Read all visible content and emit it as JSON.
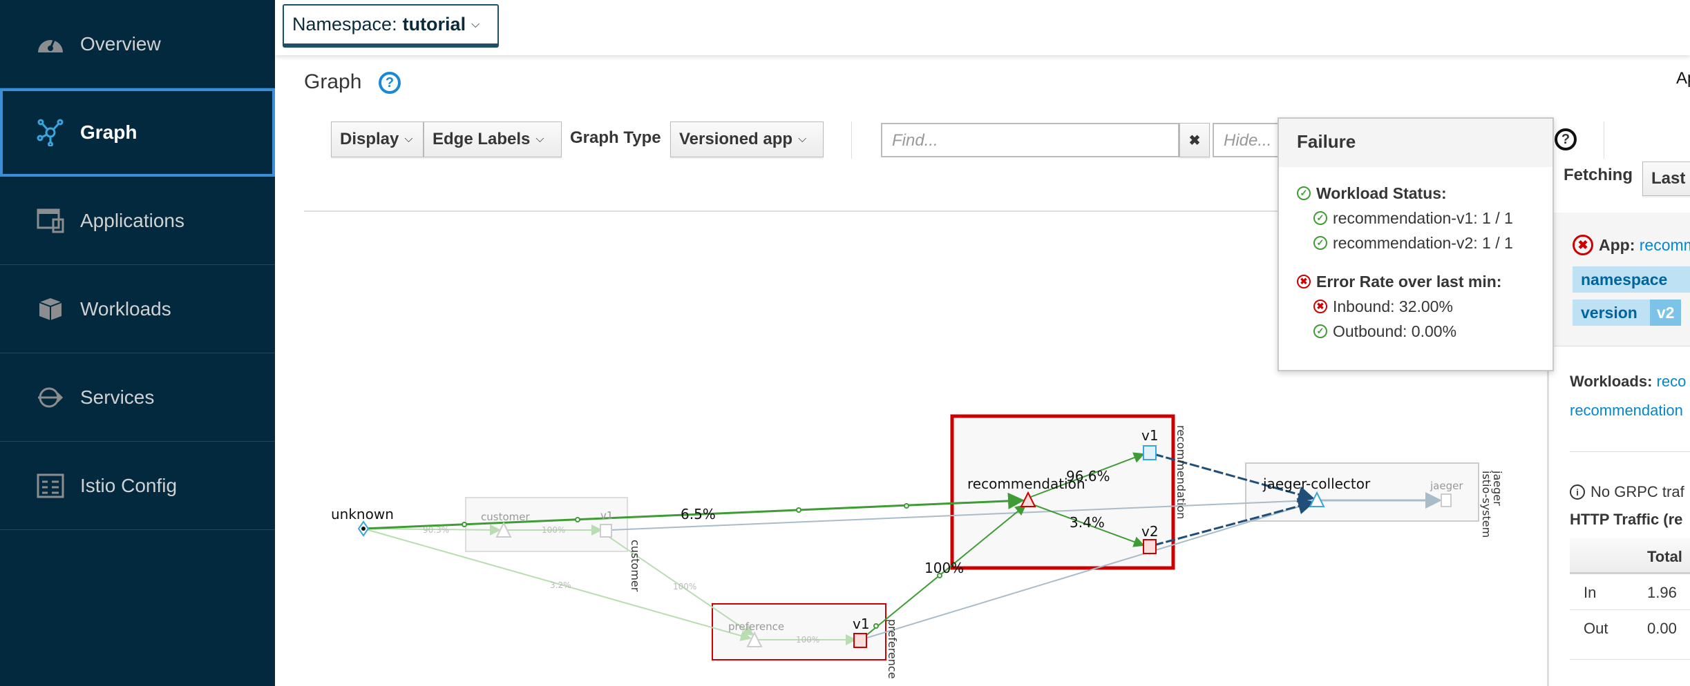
{
  "sidebar": {
    "items": [
      {
        "label": "Overview",
        "icon": "dashboard-icon"
      },
      {
        "label": "Graph",
        "icon": "topology-icon",
        "active": true
      },
      {
        "label": "Applications",
        "icon": "applications-icon"
      },
      {
        "label": "Workloads",
        "icon": "workloads-icon"
      },
      {
        "label": "Services",
        "icon": "services-icon"
      },
      {
        "label": "Istio Config",
        "icon": "config-icon"
      }
    ]
  },
  "header": {
    "namespace_prefix": "Namespace:",
    "namespace": "tutorial"
  },
  "page": {
    "title": "Graph",
    "right_cut_text": "Ap"
  },
  "toolbar": {
    "display": "Display",
    "edge_labels": "Edge Labels",
    "graph_type_label": "Graph Type",
    "graph_type": "Versioned app",
    "find_placeholder": "Find...",
    "hide_placeholder": "Hide...",
    "clear": "✖",
    "fetching_label": "Fetching",
    "fetching_value": "Last"
  },
  "popover": {
    "title": "Failure",
    "workload_status": "Workload Status:",
    "workloads": [
      "recommendation-v1: 1 / 1",
      "recommendation-v2: 1 / 1"
    ],
    "error_rate": "Error Rate over last min:",
    "inbound": "Inbound: 32.00%",
    "outbound": "Outbound: 0.00%"
  },
  "side_panel": {
    "app_label": "App:",
    "app_value": "recomm",
    "badges": [
      {
        "key": "namespace",
        "value": ""
      },
      {
        "key": "version",
        "value": "v2"
      }
    ],
    "workloads_label": "Workloads:",
    "workloads_link1": "reco",
    "workloads_link2": "recommendation",
    "grpc_note": "No GRPC traf",
    "http_title": "HTTP Traffic (re",
    "table": {
      "header": [
        "",
        "Total"
      ],
      "rows": [
        [
          "In",
          "1.96"
        ],
        [
          "Out",
          "0.00"
        ]
      ]
    }
  },
  "graph": {
    "nodes": {
      "unknown": "unknown",
      "customer": "customer",
      "customer_v1": "v1",
      "customer_box": "customer",
      "preference": "preference",
      "preference_v1": "v1",
      "preference_box": "preference",
      "recommendation": "recommendation",
      "rec_v1": "v1",
      "rec_v2": "v2",
      "rec_box": "recommendation",
      "jaeger_collector": "jaeger-collector",
      "jaeger": "jaeger",
      "jaeger_box_app": "jaeger",
      "jaeger_box_ns": "istio-system"
    },
    "edges": {
      "unknown_customer": "90.3%",
      "customer_v1": "100%",
      "unknown_recommendation": "6.5%",
      "unknown_preference": "3.2%",
      "customer_preference": "100%",
      "preference_v1": "100%",
      "preference_recommendation": "100%",
      "rec_v1": "96.6%",
      "rec_v2": "3.4%"
    },
    "colors": {
      "healthy_edge": "#3f9c35",
      "faded_edge": "#b9dcb1",
      "failure": "#cc0000",
      "tcp_edge": "#1f4e79",
      "idle_edge": "#a9bcc9"
    }
  }
}
